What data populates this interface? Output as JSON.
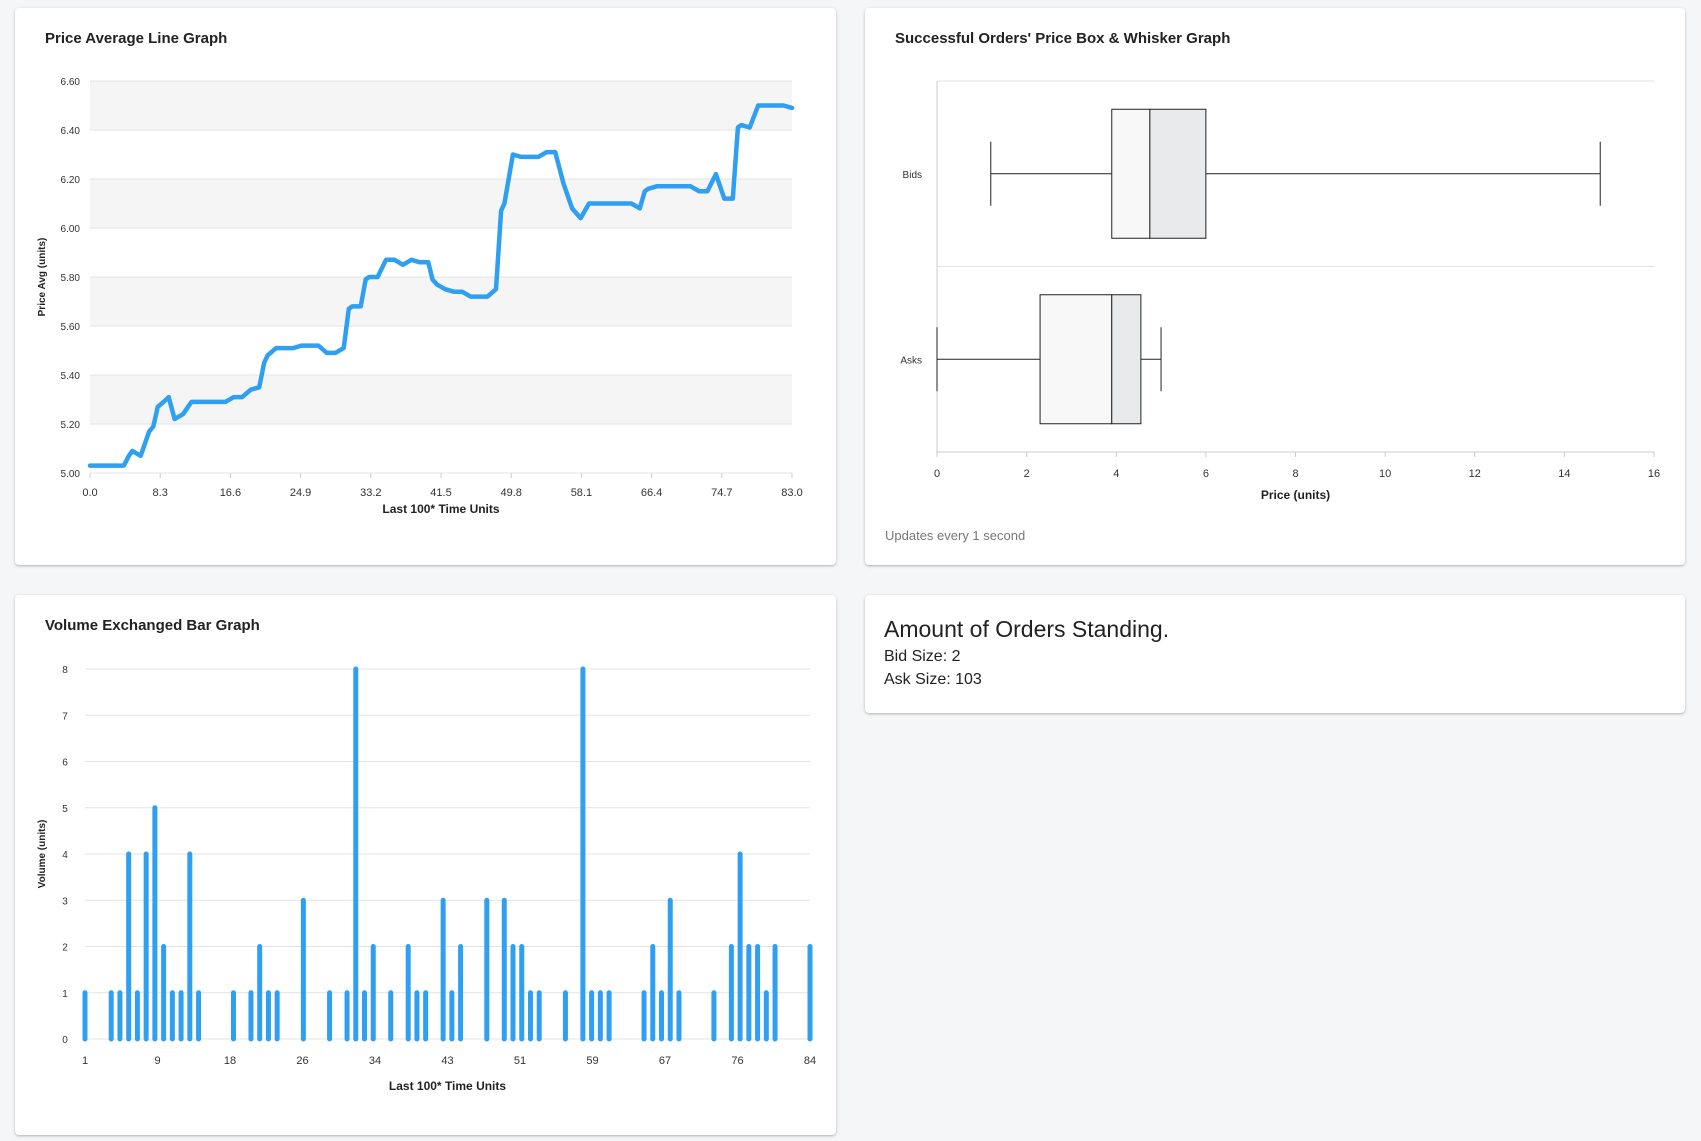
{
  "line_card": {
    "title": "Price Average Line Graph"
  },
  "box_card": {
    "title": "Successful Orders' Price Box & Whisker Graph",
    "footnote": "Updates every 1 second"
  },
  "bar_card": {
    "title": "Volume Exchanged Bar Graph"
  },
  "orders_card": {
    "heading": "Amount of Orders Standing.",
    "bid_label": "Bid Size: 2",
    "ask_label": "Ask Size: 103"
  },
  "colors": {
    "series": "#2f9ff2",
    "grid": "#e3e3e3",
    "band": "#f5f5f5",
    "box_light": "#f8f8f9",
    "box_dark": "#e9eaeb"
  },
  "chart_data": [
    {
      "type": "line",
      "title": "Price Average Line Graph",
      "xlabel": "Last 100* Time Units",
      "ylabel": "Price Avg (units)",
      "xlim": [
        0,
        83
      ],
      "ylim": [
        5.0,
        6.6
      ],
      "x_ticks": [
        "0.0",
        "8.3",
        "16.6",
        "24.9",
        "33.2",
        "41.5",
        "49.8",
        "58.1",
        "66.4",
        "74.7",
        "83.0"
      ],
      "y_ticks": [
        "5.00",
        "5.20",
        "5.40",
        "5.60",
        "5.80",
        "6.00",
        "6.20",
        "6.40",
        "6.60"
      ],
      "grid": true,
      "banded": true,
      "points": [
        [
          0,
          5.03
        ],
        [
          1,
          5.03
        ],
        [
          2,
          5.03
        ],
        [
          3,
          5.03
        ],
        [
          4,
          5.03
        ],
        [
          4.6,
          5.07
        ],
        [
          5,
          5.09
        ],
        [
          6,
          5.07
        ],
        [
          7,
          5.17
        ],
        [
          7.5,
          5.19
        ],
        [
          8,
          5.27
        ],
        [
          8.7,
          5.29
        ],
        [
          9.3,
          5.31
        ],
        [
          10,
          5.22
        ],
        [
          11,
          5.24
        ],
        [
          12,
          5.29
        ],
        [
          13,
          5.29
        ],
        [
          14,
          5.29
        ],
        [
          15,
          5.29
        ],
        [
          16,
          5.29
        ],
        [
          17,
          5.31
        ],
        [
          18,
          5.31
        ],
        [
          19,
          5.34
        ],
        [
          20,
          5.35
        ],
        [
          20.6,
          5.45
        ],
        [
          21,
          5.48
        ],
        [
          22,
          5.51
        ],
        [
          23,
          5.51
        ],
        [
          24,
          5.51
        ],
        [
          25,
          5.52
        ],
        [
          26,
          5.52
        ],
        [
          27,
          5.52
        ],
        [
          28,
          5.49
        ],
        [
          29,
          5.49
        ],
        [
          30,
          5.51
        ],
        [
          30.6,
          5.67
        ],
        [
          31,
          5.68
        ],
        [
          32,
          5.68
        ],
        [
          32.6,
          5.79
        ],
        [
          33,
          5.8
        ],
        [
          34,
          5.8
        ],
        [
          35,
          5.87
        ],
        [
          36,
          5.87
        ],
        [
          37,
          5.85
        ],
        [
          38,
          5.87
        ],
        [
          39,
          5.86
        ],
        [
          40,
          5.86
        ],
        [
          40.5,
          5.79
        ],
        [
          41,
          5.77
        ],
        [
          42,
          5.75
        ],
        [
          43,
          5.74
        ],
        [
          44,
          5.74
        ],
        [
          45,
          5.72
        ],
        [
          46,
          5.72
        ],
        [
          47,
          5.72
        ],
        [
          48,
          5.75
        ],
        [
          48.6,
          6.07
        ],
        [
          49,
          6.1
        ],
        [
          50,
          6.3
        ],
        [
          51,
          6.29
        ],
        [
          52,
          6.29
        ],
        [
          53,
          6.29
        ],
        [
          54,
          6.31
        ],
        [
          55,
          6.31
        ],
        [
          56,
          6.18
        ],
        [
          57,
          6.08
        ],
        [
          58,
          6.04
        ],
        [
          59,
          6.1
        ],
        [
          60,
          6.1
        ],
        [
          61,
          6.1
        ],
        [
          62,
          6.1
        ],
        [
          63,
          6.1
        ],
        [
          64,
          6.1
        ],
        [
          65,
          6.08
        ],
        [
          65.6,
          6.15
        ],
        [
          66,
          6.16
        ],
        [
          67,
          6.17
        ],
        [
          68,
          6.17
        ],
        [
          69,
          6.17
        ],
        [
          70,
          6.17
        ],
        [
          71,
          6.17
        ],
        [
          72,
          6.15
        ],
        [
          73,
          6.15
        ],
        [
          74,
          6.22
        ],
        [
          75,
          6.12
        ],
        [
          76,
          6.12
        ],
        [
          76.6,
          6.41
        ],
        [
          77,
          6.42
        ],
        [
          78,
          6.41
        ],
        [
          79,
          6.5
        ],
        [
          80,
          6.5
        ],
        [
          81,
          6.5
        ],
        [
          82,
          6.5
        ],
        [
          83,
          6.49
        ]
      ]
    },
    {
      "type": "box",
      "title": "Successful Orders' Price Box & Whisker Graph",
      "xlabel": "Price (units)",
      "xlim": [
        0,
        16
      ],
      "x_ticks": [
        "0",
        "2",
        "4",
        "6",
        "8",
        "10",
        "12",
        "14",
        "16"
      ],
      "categories": [
        "Bids",
        "Asks"
      ],
      "boxes": [
        {
          "name": "Bids",
          "min": 1.2,
          "q1": 3.9,
          "median": 4.75,
          "q3": 6.0,
          "max": 14.8
        },
        {
          "name": "Asks",
          "min": 0.0,
          "q1": 2.3,
          "median": 3.9,
          "q3": 4.55,
          "max": 5.0
        }
      ]
    },
    {
      "type": "bar",
      "title": "Volume Exchanged Bar Graph",
      "xlabel": "Last 100* Time Units",
      "ylabel": "Volume (units)",
      "xlim": [
        1,
        84
      ],
      "ylim": [
        0,
        8
      ],
      "x_ticks": [
        "1",
        "9",
        "18",
        "26",
        "34",
        "43",
        "51",
        "59",
        "67",
        "76",
        "84"
      ],
      "y_ticks": [
        "0",
        "1",
        "2",
        "3",
        "4",
        "5",
        "6",
        "7",
        "8"
      ],
      "grid": true,
      "x": [
        1,
        4,
        5,
        6,
        7,
        8,
        9,
        10,
        11,
        12,
        13,
        14,
        18,
        20,
        21,
        22,
        23,
        26,
        29,
        31,
        32,
        33,
        34,
        36,
        38,
        39,
        40,
        42,
        43,
        44,
        47,
        49,
        50,
        51,
        52,
        53,
        56,
        58,
        59,
        60,
        61,
        65,
        66,
        67,
        68,
        69,
        73,
        75,
        76,
        77,
        78,
        79,
        80,
        84
      ],
      "values": [
        1,
        1,
        1,
        4,
        1,
        4,
        5,
        2,
        1,
        1,
        4,
        1,
        1,
        1,
        2,
        1,
        1,
        3,
        1,
        1,
        8,
        1,
        2,
        1,
        2,
        1,
        1,
        3,
        1,
        2,
        3,
        3,
        2,
        2,
        1,
        1,
        1,
        8,
        1,
        1,
        1,
        1,
        2,
        1,
        3,
        1,
        1,
        2,
        4,
        2,
        2,
        1,
        2,
        2
      ]
    }
  ]
}
